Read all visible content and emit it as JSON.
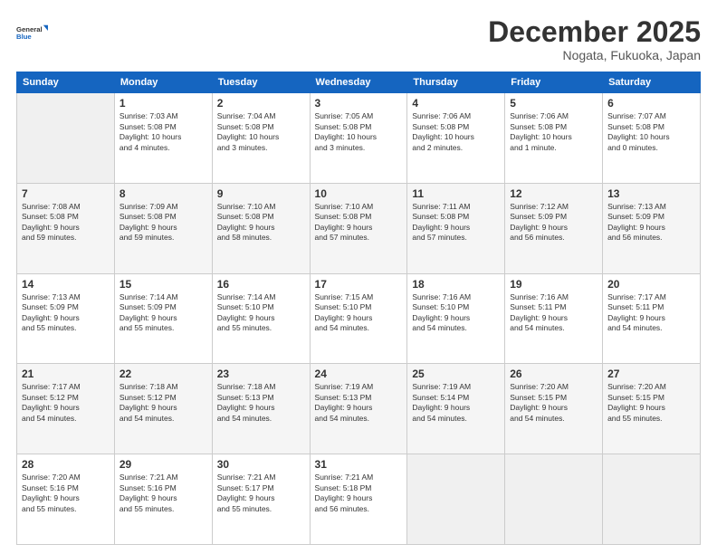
{
  "header": {
    "logo_line1": "General",
    "logo_line2": "Blue",
    "title": "December 2025",
    "subtitle": "Nogata, Fukuoka, Japan"
  },
  "weekdays": [
    "Sunday",
    "Monday",
    "Tuesday",
    "Wednesday",
    "Thursday",
    "Friday",
    "Saturday"
  ],
  "weeks": [
    [
      {
        "day": "",
        "info": ""
      },
      {
        "day": "1",
        "info": "Sunrise: 7:03 AM\nSunset: 5:08 PM\nDaylight: 10 hours\nand 4 minutes."
      },
      {
        "day": "2",
        "info": "Sunrise: 7:04 AM\nSunset: 5:08 PM\nDaylight: 10 hours\nand 3 minutes."
      },
      {
        "day": "3",
        "info": "Sunrise: 7:05 AM\nSunset: 5:08 PM\nDaylight: 10 hours\nand 3 minutes."
      },
      {
        "day": "4",
        "info": "Sunrise: 7:06 AM\nSunset: 5:08 PM\nDaylight: 10 hours\nand 2 minutes."
      },
      {
        "day": "5",
        "info": "Sunrise: 7:06 AM\nSunset: 5:08 PM\nDaylight: 10 hours\nand 1 minute."
      },
      {
        "day": "6",
        "info": "Sunrise: 7:07 AM\nSunset: 5:08 PM\nDaylight: 10 hours\nand 0 minutes."
      }
    ],
    [
      {
        "day": "7",
        "info": "Sunrise: 7:08 AM\nSunset: 5:08 PM\nDaylight: 9 hours\nand 59 minutes."
      },
      {
        "day": "8",
        "info": "Sunrise: 7:09 AM\nSunset: 5:08 PM\nDaylight: 9 hours\nand 59 minutes."
      },
      {
        "day": "9",
        "info": "Sunrise: 7:10 AM\nSunset: 5:08 PM\nDaylight: 9 hours\nand 58 minutes."
      },
      {
        "day": "10",
        "info": "Sunrise: 7:10 AM\nSunset: 5:08 PM\nDaylight: 9 hours\nand 57 minutes."
      },
      {
        "day": "11",
        "info": "Sunrise: 7:11 AM\nSunset: 5:08 PM\nDaylight: 9 hours\nand 57 minutes."
      },
      {
        "day": "12",
        "info": "Sunrise: 7:12 AM\nSunset: 5:09 PM\nDaylight: 9 hours\nand 56 minutes."
      },
      {
        "day": "13",
        "info": "Sunrise: 7:13 AM\nSunset: 5:09 PM\nDaylight: 9 hours\nand 56 minutes."
      }
    ],
    [
      {
        "day": "14",
        "info": "Sunrise: 7:13 AM\nSunset: 5:09 PM\nDaylight: 9 hours\nand 55 minutes."
      },
      {
        "day": "15",
        "info": "Sunrise: 7:14 AM\nSunset: 5:09 PM\nDaylight: 9 hours\nand 55 minutes."
      },
      {
        "day": "16",
        "info": "Sunrise: 7:14 AM\nSunset: 5:10 PM\nDaylight: 9 hours\nand 55 minutes."
      },
      {
        "day": "17",
        "info": "Sunrise: 7:15 AM\nSunset: 5:10 PM\nDaylight: 9 hours\nand 54 minutes."
      },
      {
        "day": "18",
        "info": "Sunrise: 7:16 AM\nSunset: 5:10 PM\nDaylight: 9 hours\nand 54 minutes."
      },
      {
        "day": "19",
        "info": "Sunrise: 7:16 AM\nSunset: 5:11 PM\nDaylight: 9 hours\nand 54 minutes."
      },
      {
        "day": "20",
        "info": "Sunrise: 7:17 AM\nSunset: 5:11 PM\nDaylight: 9 hours\nand 54 minutes."
      }
    ],
    [
      {
        "day": "21",
        "info": "Sunrise: 7:17 AM\nSunset: 5:12 PM\nDaylight: 9 hours\nand 54 minutes."
      },
      {
        "day": "22",
        "info": "Sunrise: 7:18 AM\nSunset: 5:12 PM\nDaylight: 9 hours\nand 54 minutes."
      },
      {
        "day": "23",
        "info": "Sunrise: 7:18 AM\nSunset: 5:13 PM\nDaylight: 9 hours\nand 54 minutes."
      },
      {
        "day": "24",
        "info": "Sunrise: 7:19 AM\nSunset: 5:13 PM\nDaylight: 9 hours\nand 54 minutes."
      },
      {
        "day": "25",
        "info": "Sunrise: 7:19 AM\nSunset: 5:14 PM\nDaylight: 9 hours\nand 54 minutes."
      },
      {
        "day": "26",
        "info": "Sunrise: 7:20 AM\nSunset: 5:15 PM\nDaylight: 9 hours\nand 54 minutes."
      },
      {
        "day": "27",
        "info": "Sunrise: 7:20 AM\nSunset: 5:15 PM\nDaylight: 9 hours\nand 55 minutes."
      }
    ],
    [
      {
        "day": "28",
        "info": "Sunrise: 7:20 AM\nSunset: 5:16 PM\nDaylight: 9 hours\nand 55 minutes."
      },
      {
        "day": "29",
        "info": "Sunrise: 7:21 AM\nSunset: 5:16 PM\nDaylight: 9 hours\nand 55 minutes."
      },
      {
        "day": "30",
        "info": "Sunrise: 7:21 AM\nSunset: 5:17 PM\nDaylight: 9 hours\nand 55 minutes."
      },
      {
        "day": "31",
        "info": "Sunrise: 7:21 AM\nSunset: 5:18 PM\nDaylight: 9 hours\nand 56 minutes."
      },
      {
        "day": "",
        "info": ""
      },
      {
        "day": "",
        "info": ""
      },
      {
        "day": "",
        "info": ""
      }
    ]
  ]
}
